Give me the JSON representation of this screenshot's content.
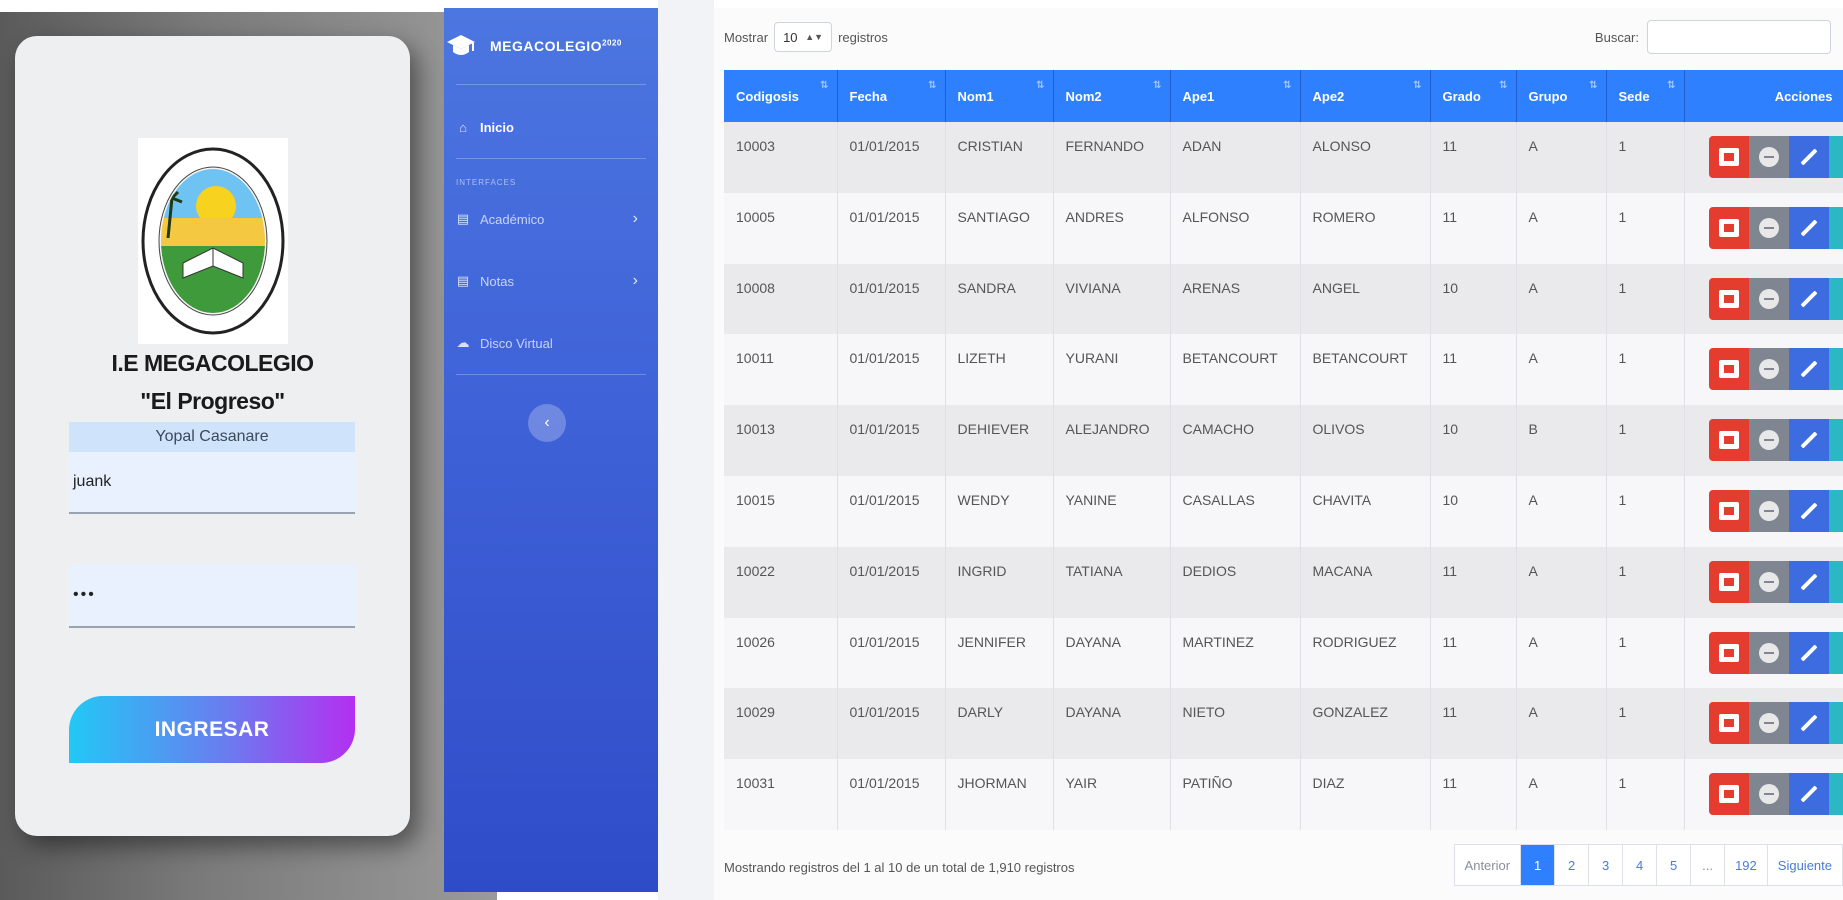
{
  "login": {
    "school_line1": "I.E MEGACOLEGIO",
    "school_line2": "\"El Progreso\"",
    "city": "Yopal Casanare",
    "username_value": "juank",
    "password_value": "•••",
    "login_button": "INGRESAR"
  },
  "sidebar": {
    "brand": "MEGACOLEGIO",
    "brand_sup": "2020",
    "items": [
      {
        "label": "Inicio",
        "icon": "home-icon"
      },
      {
        "label": "Académico",
        "icon": "table-icon"
      },
      {
        "label": "Notas",
        "icon": "table-icon"
      },
      {
        "label": "Disco Virtual",
        "icon": "cloud-icon"
      }
    ],
    "heading": "INTERFACES"
  },
  "controls": {
    "show_prefix": "Mostrar",
    "page_size": "10",
    "show_suffix": "registros",
    "search_label": "Buscar:",
    "search_value": ""
  },
  "table": {
    "columns": [
      "Codigosis",
      "Fecha",
      "Nom1",
      "Nom2",
      "Ape1",
      "Ape2",
      "Grado",
      "Grupo",
      "Sede",
      "Acciones"
    ],
    "rows": [
      [
        "10003",
        "01/01/2015",
        "CRISTIAN",
        "FERNANDO",
        "ADAN",
        "ALONSO",
        "11",
        "A",
        "1"
      ],
      [
        "10005",
        "01/01/2015",
        "SANTIAGO",
        "ANDRES",
        "ALFONSO",
        "ROMERO",
        "11",
        "A",
        "1"
      ],
      [
        "10008",
        "01/01/2015",
        "SANDRA",
        "VIVIANA",
        "ARENAS",
        "ANGEL",
        "10",
        "A",
        "1"
      ],
      [
        "10011",
        "01/01/2015",
        "LIZETH",
        "YURANI",
        "BETANCOURT",
        "BETANCOURT",
        "11",
        "A",
        "1"
      ],
      [
        "10013",
        "01/01/2015",
        "DEHIEVER",
        "ALEJANDRO",
        "CAMACHO",
        "OLIVOS",
        "10",
        "B",
        "1"
      ],
      [
        "10015",
        "01/01/2015",
        "WENDY",
        "YANINE",
        "CASALLAS",
        "CHAVITA",
        "10",
        "A",
        "1"
      ],
      [
        "10022",
        "01/01/2015",
        "INGRID",
        "TATIANA",
        "DEDIOS",
        "MACANA",
        "11",
        "A",
        "1"
      ],
      [
        "10026",
        "01/01/2015",
        "JENNIFER",
        "DAYANA",
        "MARTINEZ",
        "RODRIGUEZ",
        "11",
        "A",
        "1"
      ],
      [
        "10029",
        "01/01/2015",
        "DARLY",
        "DAYANA",
        "NIETO",
        "GONZALEZ",
        "11",
        "A",
        "1"
      ],
      [
        "10031",
        "01/01/2015",
        "JHORMAN",
        "YAIR",
        "PATIÑO",
        "DIAZ",
        "11",
        "A",
        "1"
      ]
    ]
  },
  "footer": {
    "info": "Mostrando registros del 1 al 10 de un total de 1,910 registros",
    "pagination": [
      "Anterior",
      "1",
      "2",
      "3",
      "4",
      "5",
      "...",
      "192",
      "Siguiente"
    ]
  },
  "colors": {
    "header_blue": "#2f80ff",
    "action_red": "#e43d30",
    "action_grey": "#7f8692",
    "action_blue": "#3d6be0",
    "action_teal": "#2bb8c4"
  }
}
